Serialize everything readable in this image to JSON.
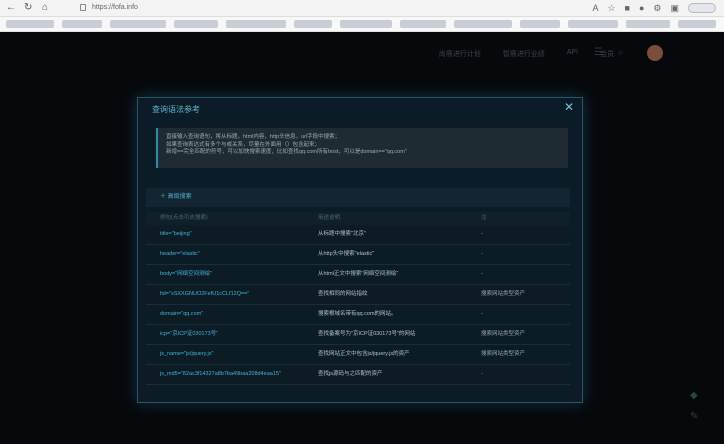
{
  "browser": {
    "url": "https://fofa.info",
    "nav_icons": [
      "back-icon",
      "refresh-icon",
      "home-icon"
    ]
  },
  "header": {
    "nav": [
      "尚需进行计划",
      "暂需进行业绩",
      "API",
      "会员"
    ]
  },
  "modal": {
    "title": "查询语法参考",
    "close": "✕",
    "hint_lines": [
      "直接输入查询语句，将从标题，html内容，http头信息，url字段中搜索；",
      "如果查询表达式有多个与或关系，尽量在外面用（）包含起来；",
      "新增==完全匹配的符号，可以加快搜索速度，比如查找qq.com所有host，可以是domain==\"qq.com\""
    ],
    "advanced_label": "＋ 高级搜索",
    "columns": [
      "例句(点击可去搜索)",
      "用途说明",
      "注"
    ],
    "rows": [
      {
        "query": "title=\"beijing\"",
        "desc": "从标题中搜索\"北京\"",
        "note": "-"
      },
      {
        "query": "header=\"elastic\"",
        "desc": "从http头中搜索\"elastic\"",
        "note": "-"
      },
      {
        "query": "body=\"网络空间测绘\"",
        "desc": "从html正文中搜索\"网络空间测绘\"",
        "note": "-"
      },
      {
        "query": "fid=\"sSXXGNUO2FefU1cCLf12Q==\"",
        "desc": "查找相同的网站指纹",
        "note": "搜索网站类型资产"
      },
      {
        "query": "domain=\"qq.com\"",
        "desc": "搜索根域名带有qq.com的网站。",
        "note": "-"
      },
      {
        "query": "icp=\"京ICP证030173号\"",
        "desc": "查找备案号为\"京ICP证030173号\"的网站",
        "note": "搜索网站类型资产"
      },
      {
        "query": "js_name=\"js/jquery.js\"",
        "desc": "查找网站正文中包含js/jquery.js的资产",
        "note": "搜索网站类型资产"
      },
      {
        "query": "js_md5=\"82ac3f14327a8b7ba49baa208d4eaa15\"",
        "desc": "查找js源码与之匹配的资产",
        "note": "-"
      }
    ]
  }
}
